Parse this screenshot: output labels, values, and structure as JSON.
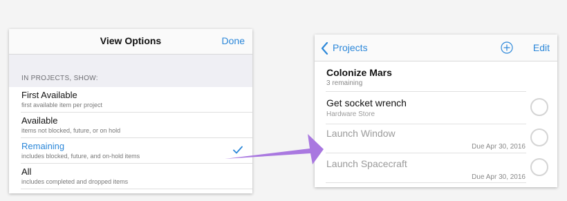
{
  "view_options": {
    "title": "View Options",
    "done_label": "Done",
    "section_header": "IN PROJECTS, SHOW:",
    "options": [
      {
        "label": "First Available",
        "desc": "first available item per project",
        "selected": false
      },
      {
        "label": "Available",
        "desc": "items not blocked, future, or on hold",
        "selected": false
      },
      {
        "label": "Remaining",
        "desc": "includes blocked, future, and on-hold items",
        "selected": true
      },
      {
        "label": "All",
        "desc": "includes completed and dropped items",
        "selected": false
      }
    ],
    "check_icon": "checkmark-icon"
  },
  "projects": {
    "back_label": "Projects",
    "add_icon": "plus-circle-icon",
    "edit_label": "Edit",
    "project_title": "Colonize Mars",
    "project_subtitle": "3 remaining",
    "tasks": [
      {
        "title": "Get socket wrench",
        "subtitle": "Hardware Store",
        "due": ""
      },
      {
        "title": "Launch Window",
        "subtitle": "",
        "due": "Due Apr 30, 2016"
      },
      {
        "title": "Launch Spacecraft",
        "subtitle": "",
        "due": "Due Apr 30, 2016"
      }
    ]
  },
  "colors": {
    "accent": "#2b87d9",
    "arrow": "#a978e0",
    "background": "#f4f4f4"
  }
}
